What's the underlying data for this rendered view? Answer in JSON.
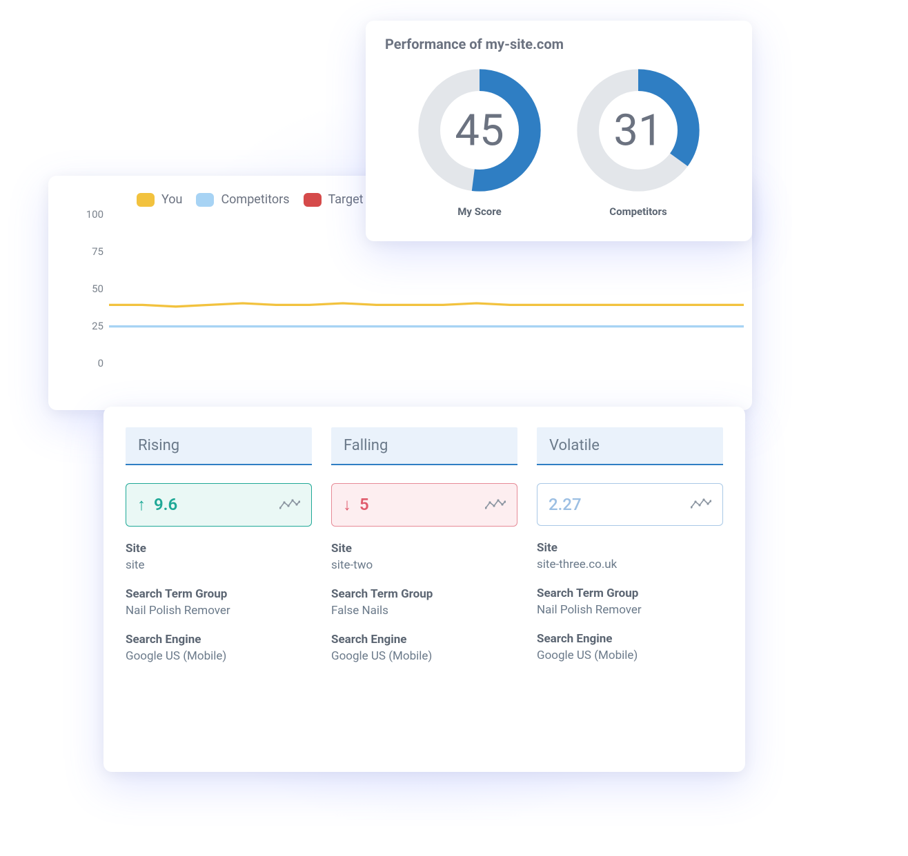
{
  "performance": {
    "title": "Performance of my-site.com",
    "donuts": [
      {
        "label": "My Score",
        "value": 45,
        "percent": 52
      },
      {
        "label": "Competitors",
        "value": 31,
        "percent": 35
      }
    ],
    "colors": {
      "ring_bg": "#e3e6ea",
      "ring_fg": "#2f7ec3"
    }
  },
  "chart_data": {
    "type": "line",
    "ylabel": "",
    "xlabel": "",
    "ylim": [
      0,
      100
    ],
    "y_ticks": [
      0,
      25,
      50,
      75,
      100
    ],
    "legend": [
      "You",
      "Competitors",
      "Target"
    ],
    "series": [
      {
        "name": "You",
        "color": "#f2c23e",
        "values": [
          44,
          44,
          43,
          44,
          45,
          44,
          44,
          45,
          44,
          44,
          44,
          45,
          44,
          44,
          44,
          44,
          44,
          44,
          44,
          44
        ]
      },
      {
        "name": "Competitors",
        "color": "#a7d3f4",
        "values": [
          31,
          31,
          31,
          31,
          31,
          31,
          31,
          31,
          31,
          31,
          31,
          31,
          31,
          31,
          31,
          31,
          31,
          31,
          31,
          31
        ]
      },
      {
        "name": "Target",
        "color": "#d54a4a",
        "values": []
      }
    ]
  },
  "metrics": {
    "columns": [
      {
        "tab": "Rising",
        "kind": "rising",
        "arrow": "↑",
        "value": "9.6",
        "site_label": "Site",
        "site_value": "site",
        "stg_label": "Search Term Group",
        "stg_value": "Nail Polish Remover",
        "se_label": "Search Engine",
        "se_value": "Google US (Mobile)"
      },
      {
        "tab": "Falling",
        "kind": "falling",
        "arrow": "↓",
        "value": "5",
        "site_label": "Site",
        "site_value": "site-two",
        "stg_label": "Search Term Group",
        "stg_value": "False Nails",
        "se_label": "Search Engine",
        "se_value": "Google US (Mobile)"
      },
      {
        "tab": "Volatile",
        "kind": "volatile",
        "arrow": "",
        "value": "2.27",
        "site_label": "Site",
        "site_value": "site-three.co.uk",
        "stg_label": "Search Term Group",
        "stg_value": "Nail Polish Remover",
        "se_label": "Search Engine",
        "se_value": "Google US (Mobile)"
      }
    ]
  }
}
